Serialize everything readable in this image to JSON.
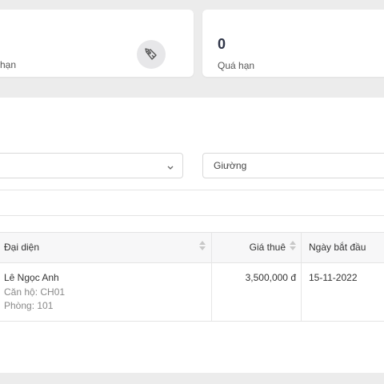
{
  "cards": {
    "left": {
      "label": "hạn"
    },
    "right": {
      "value": "0",
      "label": "Quá hạn"
    }
  },
  "filters": {
    "right_select": "Giường"
  },
  "table": {
    "headers": [
      "Đại diện",
      "Giá thuê",
      "Ngày bắt đầu"
    ],
    "rows": [
      {
        "name": "Lê Ngọc Anh",
        "apartment": "Căn hộ: CH01",
        "room": "Phòng: 101",
        "price": "3,500,000 đ",
        "start_date": "15-11-2022"
      }
    ]
  }
}
